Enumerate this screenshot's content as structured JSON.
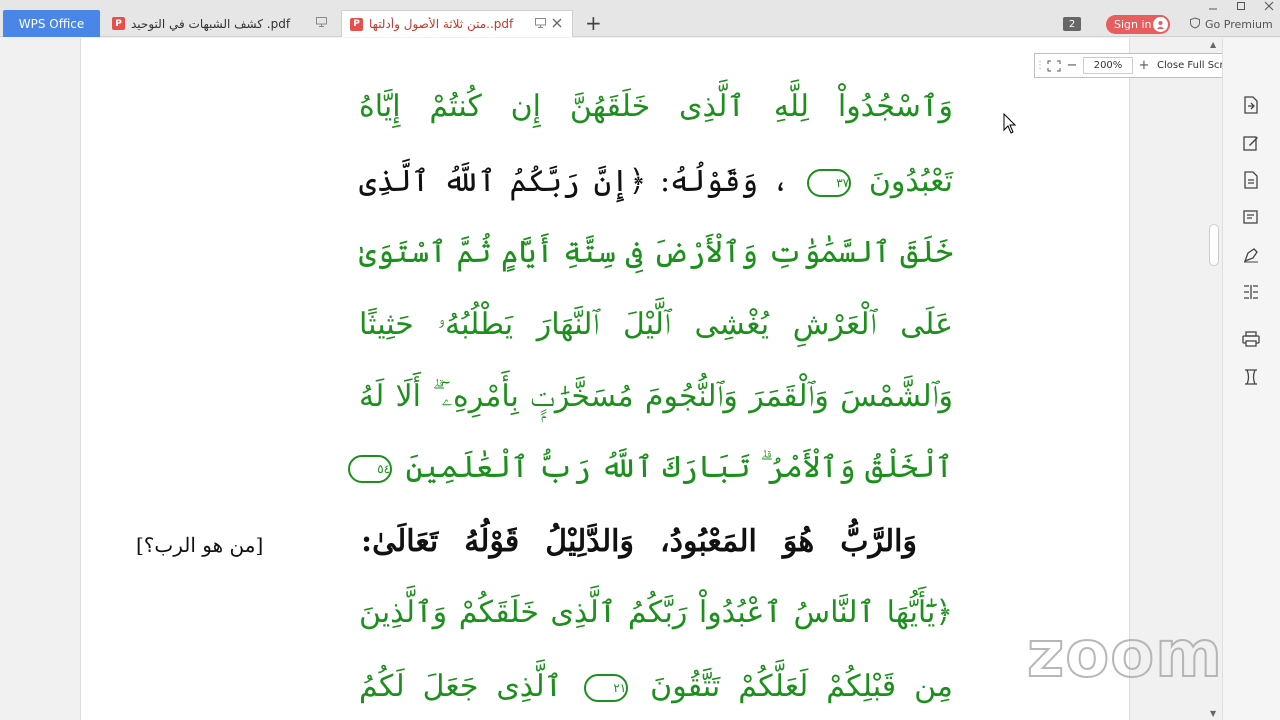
{
  "tabs": {
    "app_label": "WPS Office",
    "doc1_title": "كشف الشبهات في التوحيد .pdf",
    "doc2_title": "متن ثلاثة الأصول وأدلتها..pdf",
    "new_tab": "+"
  },
  "header": {
    "badge_count": "2",
    "sign_in": "Sign in",
    "go_premium": "Go Premium"
  },
  "zoom_bar": {
    "zoom_value": "200%",
    "close_full_screen": "Close Full Screen"
  },
  "document": {
    "lines": [
      "وَٱسْجُدُواْ لِلَّهِ ٱلَّذِى خَلَقَهُنَّ إِن كُنتُمْ إِيَّاهُ",
      "تَعْبُدُونَ",
      "٣٧",
      "، وَقَوْلُهُ: ﴿إِنَّ رَبَّكُمُ ٱللَّهُ ٱلَّذِى",
      "خَلَقَ ٱلسَّمَٰوَٰتِ وَٱلْأَرْضَ فِى سِتَّةِ أَيَّامٍ ثُمَّ ٱسْتَوَىٰ",
      "عَلَى ٱلْعَرْشِ يُغْشِى ٱلَّيْلَ ٱلنَّهَارَ يَطْلُبُهُۥ حَثِيثًا",
      "وَٱلشَّمْسَ وَٱلْقَمَرَ وَٱلنُّجُومَ مُسَخَّرَٰتٍۭ بِأَمْرِهِۦٓ ۗ أَلَا لَهُ",
      "ٱلْخَلْقُ وَٱلْأَمْرُ ۗ تَبَارَكَ ٱللَّهُ رَبُّ ٱلْعَٰلَمِينَ",
      "٥٤",
      "وَالرَّبُّ هُوَ المَعْبُودُ، وَالدَّلِيْلُ قَوْلُهُ تَعَالَىٰ:",
      "﴿يَٰٓأَيُّهَا ٱلنَّاسُ ٱعْبُدُواْ رَبَّكُمُ ٱلَّذِى خَلَقَكُمْ وَٱلَّذِينَ",
      "مِن قَبْلِكُمْ لَعَلَّكُمْ تَتَّقُونَ",
      "٢١",
      "ٱلَّذِى جَعَلَ لَكُمُ"
    ],
    "side_note": "[من هو الرب؟]"
  },
  "watermark": "zoom",
  "colors": {
    "quran_green": "#1d8f1d",
    "tab_blue": "#4a86e8",
    "signin_red": "#e85d5d"
  },
  "icons": [
    "pdf-icon",
    "monitor-icon",
    "close-icon",
    "plus-icon",
    "user-icon",
    "shield-icon",
    "minimize-icon",
    "maximize-icon",
    "window-close-icon",
    "grip-icon",
    "fit-screen-icon",
    "zoom-out-icon",
    "zoom-in-icon",
    "chevron-left-icon",
    "export-icon",
    "edit-icon",
    "convert-icon",
    "annotate-icon",
    "sign-icon",
    "compare-icon",
    "print-icon",
    "crop-icon",
    "cursor-icon"
  ]
}
